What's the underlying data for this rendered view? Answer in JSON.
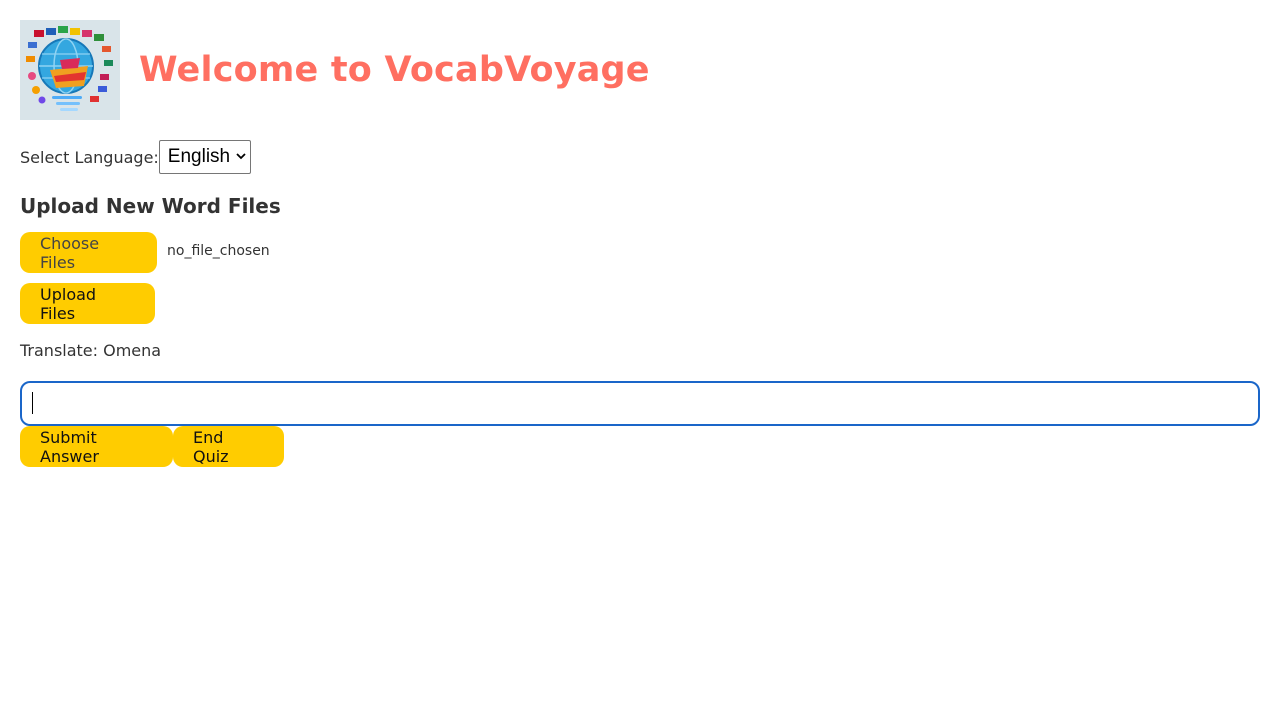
{
  "header": {
    "title": "Welcome to VocabVoyage",
    "logo_icon": "globe-with-flags-logo"
  },
  "language": {
    "label": "Select Language:",
    "selected": "English"
  },
  "upload": {
    "heading": "Upload New Word Files",
    "choose_label": "Choose Files",
    "file_status": "no_file_chosen",
    "upload_label": "Upload Files"
  },
  "quiz": {
    "prompt": "Translate: Omena",
    "answer_value": "",
    "submit_label": "Submit Answer",
    "end_label": "End Quiz"
  },
  "colors": {
    "title": "#ff6f61",
    "button": "#ffcc00",
    "input_focus_border": "#1a66c9",
    "text": "#333333"
  }
}
